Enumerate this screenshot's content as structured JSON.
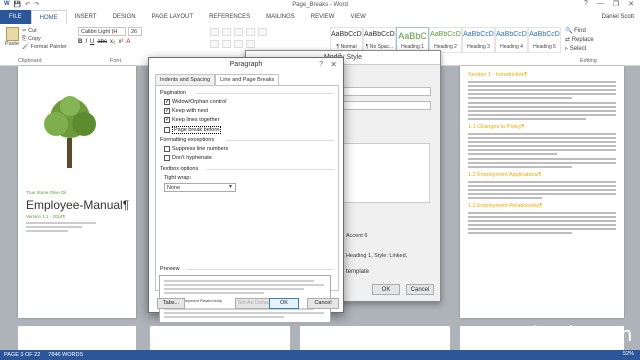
{
  "window": {
    "title": "Page_Breaks - Word",
    "controls": [
      "?",
      "—",
      "❐",
      "✕"
    ],
    "qat": [
      "W",
      "💾",
      "↶",
      "↷"
    ]
  },
  "tabs": [
    "FILE",
    "HOME",
    "INSERT",
    "DESIGN",
    "PAGE LAYOUT",
    "REFERENCES",
    "MAILINGS",
    "REVIEW",
    "VIEW"
  ],
  "user": "Daniel Scott",
  "ribbon": {
    "paste_label": "Paste",
    "clipboard_items": [
      "Cut",
      "Copy",
      "Format Painter"
    ],
    "clipboard_label": "Clipboard",
    "font_name": "Calibri Light (H",
    "font_size": "26",
    "font_label": "Font",
    "styles": [
      {
        "sample": "AaBbCcDc",
        "name": "¶ Normal"
      },
      {
        "sample": "AaBbCcDc",
        "name": "¶ No Spac..."
      },
      {
        "sample": "AaBbC",
        "name": "Heading 1"
      },
      {
        "sample": "AaBbCcD",
        "name": "Heading 2"
      },
      {
        "sample": "AaBbCcD",
        "name": "Heading 3"
      },
      {
        "sample": "AaBbCcD",
        "name": "Heading 4"
      },
      {
        "sample": "AaBbCcD",
        "name": "Heading 5"
      }
    ],
    "editing": [
      "Find",
      "Replace",
      "Select"
    ],
    "editing_label": "Editing"
  },
  "document": {
    "cover_small": "True Stone Olive Oil",
    "cover_title": "Employee-Manual¶",
    "cover_sub": "Version 1.1 - 2014¶",
    "section1": "Section 1 - Introduction¶",
    "section2": "1.1 Changes to Policy¶",
    "section3": "1.2 Employment Applications¶",
    "section4": "1.3 Employment Relationship¶"
  },
  "modify_dialog": {
    "title": "Modify Style",
    "style_based": "Heading",
    "style_next": "Normal",
    "description_tail": "Accent 6",
    "description_tail2": "Heading 1, Style: Linked,",
    "template_label": "template",
    "ok": "OK",
    "cancel": "Cancel"
  },
  "paragraph_dialog": {
    "title": "Paragraph",
    "help": "?",
    "close": "✕",
    "tabs": [
      "Indents and Spacing",
      "Line and Page Breaks"
    ],
    "pagination_label": "Pagination",
    "pagination": [
      {
        "label": "Widow/Orphan control",
        "checked": true
      },
      {
        "label": "Keep with next",
        "checked": true
      },
      {
        "label": "Keep lines together",
        "checked": true
      },
      {
        "label": "Page break before",
        "checked": false
      }
    ],
    "formatting_label": "Formatting exceptions",
    "formatting": [
      {
        "label": "Suppress line numbers",
        "checked": false
      },
      {
        "label": "Don't hyphenate",
        "checked": false
      }
    ],
    "textbox_label": "Textbox options",
    "tight_wrap_label": "Tight wrap:",
    "tight_wrap_value": "None",
    "preview_label": "Preview",
    "preview_heading": "1.3 Employment Relationship",
    "buttons": {
      "tabs": "Tabs...",
      "default": "Set As Default",
      "ok": "OK",
      "cancel": "Cancel"
    }
  },
  "status": {
    "page": "PAGE 3 OF 22",
    "words": "7846 WORDS",
    "zoom": "52%"
  },
  "watermark": "lynda.com"
}
